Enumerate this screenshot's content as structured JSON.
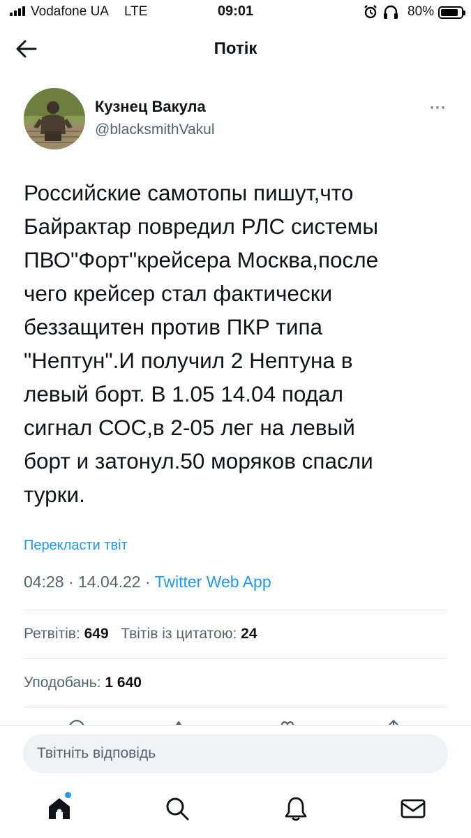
{
  "status_bar": {
    "carrier": "Vodafone UA",
    "network": "LTE",
    "time": "09:01",
    "battery": "80%",
    "battery_level": 0.8,
    "icons": [
      "signal-icon",
      "alarm-icon",
      "headphones-icon",
      "battery-icon"
    ]
  },
  "header": {
    "title": "Потік",
    "back_icon": "arrow-left-icon"
  },
  "tweet": {
    "author_name": "Кузнец Вакула",
    "author_handle": "@blacksmithVakul",
    "text_lines": [
      "Российские самотопы пишут,что",
      "Байрактар повредил РЛС системы",
      "ПВО\"Форт\"крейсера Москва,после",
      "чего крейсер стал фактически",
      "беззащитен против ПКР типа",
      "\"Нептун\".И получил 2 Нептуна в",
      "левый борт. В 1.05 14.04 подал",
      "сигнал СОС,в 2-05 лег на левый",
      "борт и затонул.50 моряков спасли",
      "турки."
    ],
    "translate_label": "Перекласти твіт",
    "time": "04:28",
    "separator": " · ",
    "date": "14.04.22",
    "source": "Twitter Web App",
    "retweets_label": "Ретвітів:",
    "retweets_count": "649",
    "quotes_label": "Твітів із цитатою:",
    "quotes_count": "24",
    "likes_label": "Уподобань:",
    "likes_count": "1 640"
  },
  "reply": {
    "placeholder": "Твітніть відповідь"
  },
  "bottom_nav": {
    "items": [
      "home-icon",
      "search-icon",
      "notifications-icon",
      "messages-icon"
    ]
  },
  "colors": {
    "accent": "#1d9bf0",
    "text": "#0f1419",
    "secondary": "#536471",
    "input_bg": "#eff3f4",
    "divider": "#e1e6ea"
  }
}
